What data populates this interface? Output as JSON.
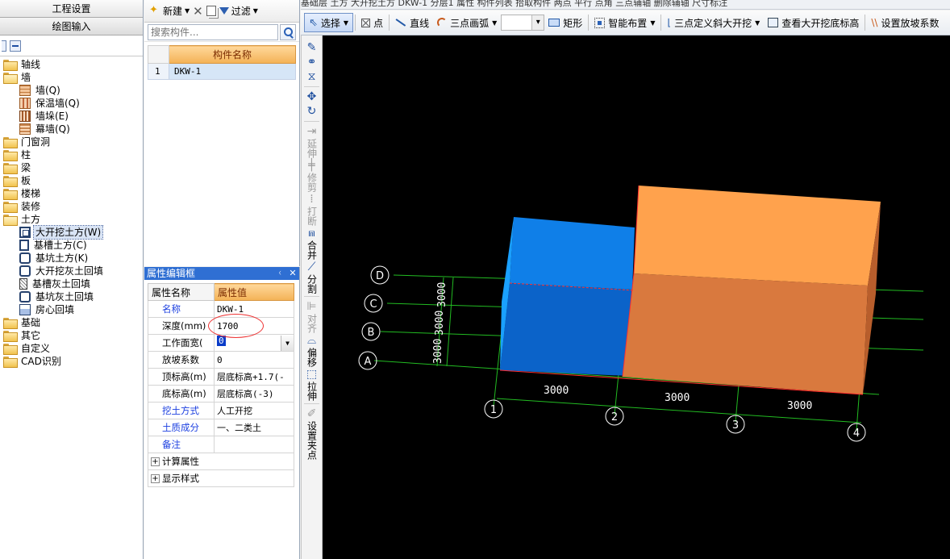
{
  "nav": {
    "tab_settings": "工程设置",
    "tab_drawing": "绘图输入",
    "tree": {
      "axis": "轴线",
      "wall_group": "墙",
      "wall": "墙(Q)",
      "insulation_wall": "保温墙(Q)",
      "wall_pier": "墙垛(E)",
      "curtain_wall": "幕墙(Q)",
      "door_window": "门窗洞",
      "column": "柱",
      "beam": "梁",
      "slab": "板",
      "stair": "楼梯",
      "decoration": "装修",
      "earthwork": "土方",
      "open_excavation": "大开挖土方(W)",
      "trench_earthwork": "基槽土方(C)",
      "pit_earthwork": "基坑土方(K)",
      "open_excavation_backfill": "大开挖灰土回填",
      "trench_backfill": "基槽灰土回填",
      "pit_backfill": "基坑灰土回填",
      "room_backfill": "房心回填",
      "foundation": "基础",
      "other": "其它",
      "custom": "自定义",
      "cad": "CAD识别"
    }
  },
  "components": {
    "new_label": "新建",
    "filter_label": "过滤",
    "search_placeholder": "搜索构件...",
    "header_name": "构件名称",
    "rows": [
      {
        "index": "1",
        "name": "DKW-1"
      }
    ]
  },
  "properties": {
    "title": "属性编辑框",
    "col_name": "属性名称",
    "col_value": "属性值",
    "rows": [
      {
        "name": "名称",
        "value": "DKW-1"
      },
      {
        "name": "深度(mm)",
        "value": "1700"
      },
      {
        "name": "工作面宽(",
        "value": "0"
      },
      {
        "name": "放坡系数",
        "value": "0"
      },
      {
        "name": "顶标高(m)",
        "value": "层底标高+1.7(-"
      },
      {
        "name": "底标高(m)",
        "value": "层底标高(-3)"
      },
      {
        "name": "挖土方式",
        "value": "人工开挖"
      },
      {
        "name": "土质成分",
        "value": "一、二类土"
      },
      {
        "name": "备注",
        "value": ""
      }
    ],
    "group_calc": "计算属性",
    "group_display": "显示样式"
  },
  "toolbar": {
    "select": "选择",
    "point": "点",
    "line": "直线",
    "arc3": "三点画弧",
    "rect": "矩形",
    "smart_layout": "智能布置",
    "slope3": "三点定义斜大开挖",
    "view_bottom": "查看大开挖底标高",
    "set_slope": "设置放坡系数"
  },
  "top_strip": {
    "text": "基础层    土方    大开挖土方    DKW-1    分层1        属性  构件列表    拾取构件      两点  平行  点角  三点辅轴  删除辅轴  尺寸标注"
  },
  "vtoolbar": {
    "extend": "延伸",
    "trim": "修剪",
    "break": "打断",
    "merge": "合并",
    "split": "分割",
    "align": "对齐",
    "offset": "偏移",
    "stretch": "拉伸",
    "grip": "设置夹点"
  },
  "canvas": {
    "axis_labels": {
      "D": "D",
      "C": "C",
      "B": "B",
      "A": "A",
      "n1": "1",
      "n2": "2",
      "n3": "3",
      "n4": "4"
    },
    "dims": {
      "d12": "3000",
      "d23": "3000",
      "d34": "3000",
      "dAB": "3000",
      "dBC": "3000",
      "dCD": "3000"
    },
    "colors": {
      "blue_box": "#1a8cff",
      "orange_box": "#f59a4a",
      "grid": "#22cc22"
    }
  }
}
